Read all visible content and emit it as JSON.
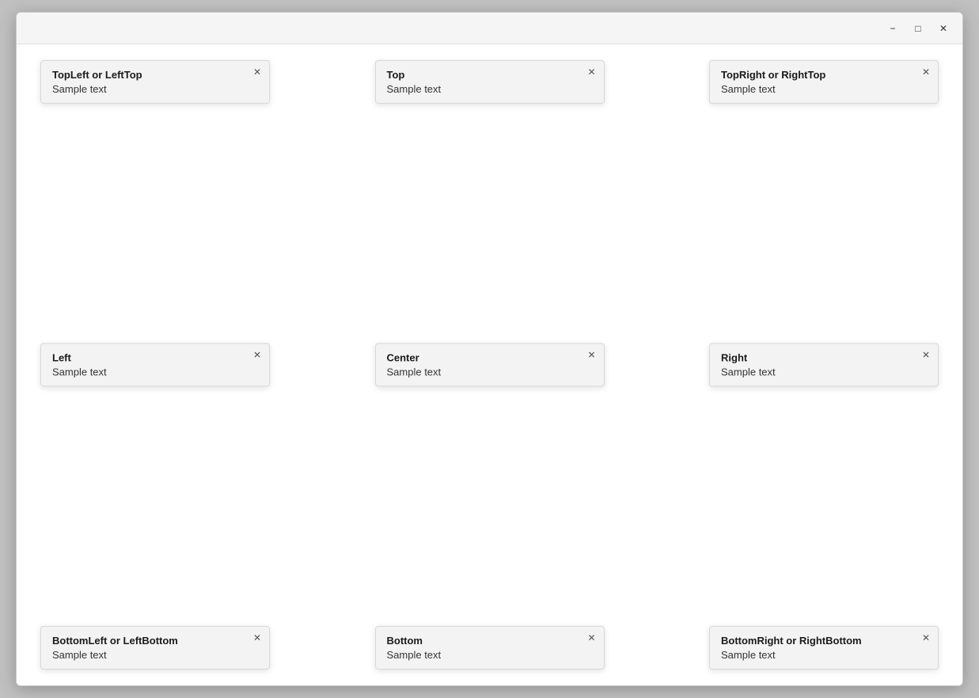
{
  "window": {
    "titlebar": {
      "minimize_label": "−",
      "maximize_label": "□",
      "close_label": "✕"
    }
  },
  "cards": {
    "topleft": {
      "title": "TopLeft or LeftTop",
      "body": "Sample text",
      "close": "✕"
    },
    "top": {
      "title": "Top",
      "body": "Sample text",
      "close": "✕"
    },
    "topright": {
      "title": "TopRight or RightTop",
      "body": "Sample text",
      "close": "✕"
    },
    "left": {
      "title": "Left",
      "body": "Sample text",
      "close": "✕"
    },
    "center": {
      "title": "Center",
      "body": "Sample text",
      "close": "✕"
    },
    "right": {
      "title": "Right",
      "body": "Sample text",
      "close": "✕"
    },
    "bottomleft": {
      "title": "BottomLeft or LeftBottom",
      "body": "Sample text",
      "close": "✕"
    },
    "bottom": {
      "title": "Bottom",
      "body": "Sample text",
      "close": "✕"
    },
    "bottomright": {
      "title": "BottomRight or RightBottom",
      "body": "Sample text",
      "close": "✕"
    }
  }
}
